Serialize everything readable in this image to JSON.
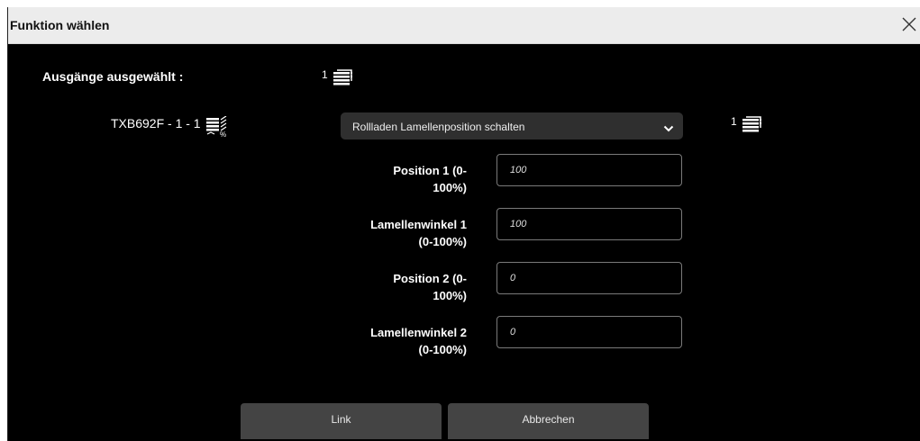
{
  "dialog": {
    "title": "Funktion wählen",
    "close_icon": "close-icon"
  },
  "outputs": {
    "label": "Ausgänge ausgewählt :",
    "count": "1",
    "icon": "blind-stack-icon"
  },
  "device": {
    "name": "TXB692F - 1 - 1",
    "icon": "blind-percent-icon"
  },
  "function_select": {
    "value": "Rollladen Lamellenposition schalten",
    "icon": "chevron-down-icon"
  },
  "target": {
    "count": "1",
    "icon": "blind-stack-icon"
  },
  "params": [
    {
      "label_l1": "Position 1 (0-",
      "label_l2": "100%)",
      "value": "100"
    },
    {
      "label_l1": "Lamellenwinkel 1",
      "label_l2": "(0-100%)",
      "value": "100"
    },
    {
      "label_l1": "Position 2 (0-",
      "label_l2": "100%)",
      "value": "0"
    },
    {
      "label_l1": "Lamellenwinkel 2",
      "label_l2": "(0-100%)",
      "value": "0"
    }
  ],
  "buttons": {
    "link": "Link",
    "cancel": "Abbrechen"
  },
  "colors": {
    "background": "#000000",
    "titlebar": "#ececec",
    "button": "#444444",
    "select": "#2f2f2f"
  }
}
